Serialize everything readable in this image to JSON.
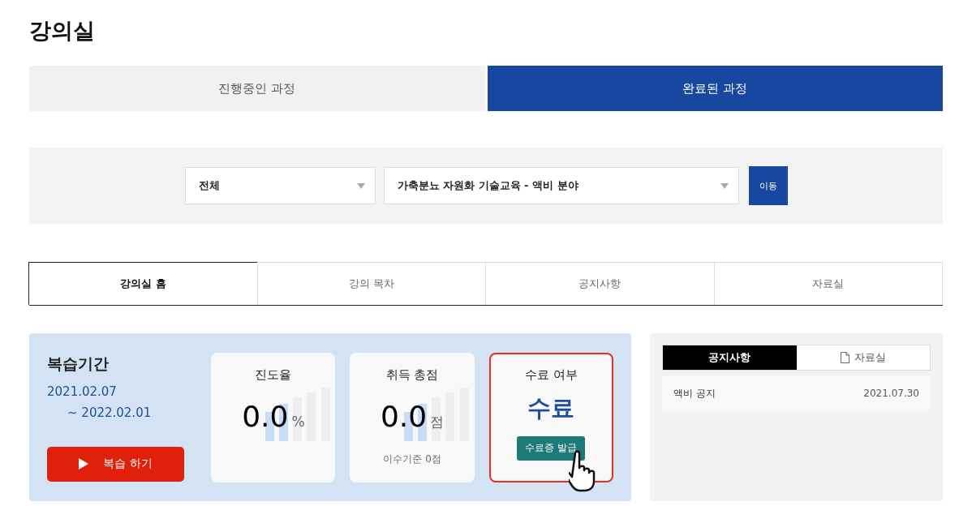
{
  "page_title": "강의실",
  "course_tabs": [
    {
      "label": "진행중인 과정",
      "selected": false
    },
    {
      "label": "완료된 과정",
      "selected": true
    }
  ],
  "filter": {
    "category": "전체",
    "course": "가축분뇨 자원화 기술교육 - 액비 분야",
    "go_button": "이동"
  },
  "section_tabs": [
    {
      "label": "강의실 홈",
      "selected": true
    },
    {
      "label": "강의 목차",
      "selected": false
    },
    {
      "label": "공지사항",
      "selected": false
    },
    {
      "label": "자료실",
      "selected": false
    }
  ],
  "review": {
    "title": "복습기간",
    "start": "2021.02.07",
    "end": "~ 2022.02.01",
    "button": "복습 하기"
  },
  "stats": [
    {
      "kind": "score",
      "title": "진도율",
      "value": "0.0",
      "unit": "%"
    },
    {
      "kind": "score",
      "title": "취득 총점",
      "value": "0.0",
      "unit": "점",
      "note": "이수기준 0점"
    },
    {
      "kind": "completion",
      "title": "수료 여부",
      "status": "수료",
      "button": "수료증 발급",
      "highlighted": true
    }
  ],
  "board": {
    "tabs": [
      {
        "label": "공지사항",
        "selected": true,
        "icon": false
      },
      {
        "label": "자료실",
        "selected": false,
        "icon": true
      }
    ],
    "items": [
      {
        "title": "액비 공지",
        "date": "2021.07.30"
      }
    ]
  }
}
